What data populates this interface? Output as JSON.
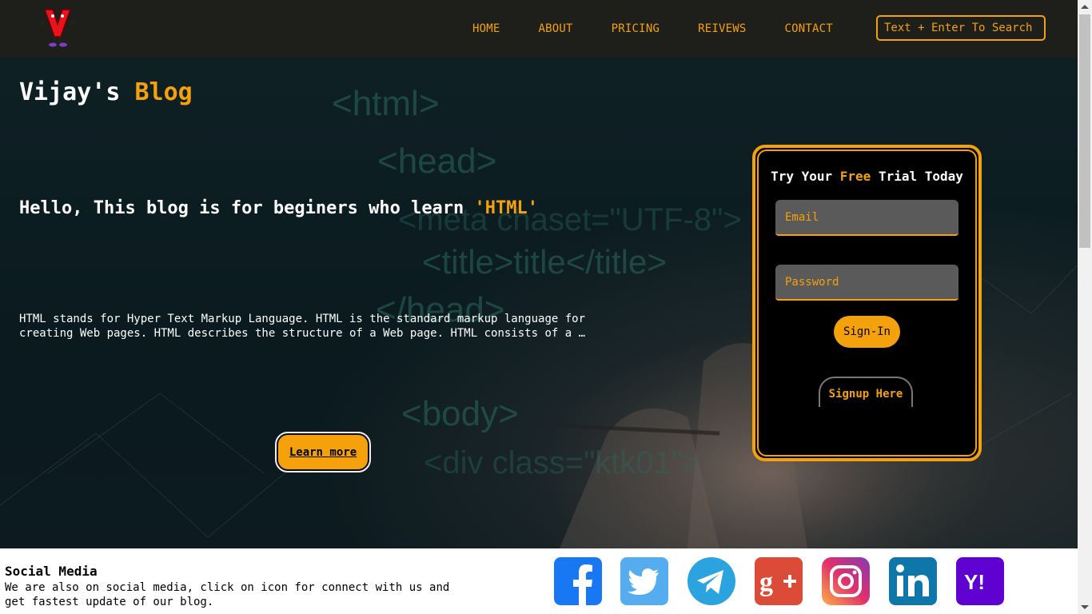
{
  "nav": {
    "links": [
      "HOME",
      "ABOUT",
      "PRICING",
      "REIVEWS",
      "CONTACT"
    ],
    "search_placeholder": "Text + Enter To Search"
  },
  "hero": {
    "title_prefix": "Vijay's",
    "title_accent": "Blog",
    "tagline_prefix": "Hello, This blog is for beginers who learn",
    "tagline_accent": "'HTML'",
    "intro": "HTML stands for Hyper Text Markup Language. HTML is the standard markup language for creating Web pages. HTML describes the structure of a Web page. HTML consists of a …",
    "learn_more": "Learn more",
    "background_code": [
      "<html>",
      "<head>",
      "<meta chaset=\"UTF-8\">",
      "<title>title</title>",
      "</head>",
      "<body>",
      "<div class=\"ktk01\">"
    ]
  },
  "trial": {
    "title_prefix": "Try Your",
    "title_accent": "Free",
    "title_suffix": "Trial Today",
    "email_placeholder": "Email",
    "password_placeholder": "Password",
    "signin": "Sign-In",
    "signup": "Signup Here"
  },
  "footer": {
    "title": "Social Media",
    "text": "We are also on social media, click on icon for connect with us and get fastest update of our blog.",
    "icons": [
      "facebook-icon",
      "twitter-icon",
      "telegram-icon",
      "google-plus-icon",
      "instagram-icon",
      "linkedin-icon",
      "yahoo-icon"
    ]
  },
  "colors": {
    "accent": "#f5a10c",
    "nav_bg": "#1e1f1b",
    "facebook": "#1877f2",
    "twitter": "#55acee",
    "telegram": "#2aa3df",
    "google_plus": "#dc4a38",
    "linkedin": "#0e76a8",
    "yahoo": "#5f01d1"
  }
}
